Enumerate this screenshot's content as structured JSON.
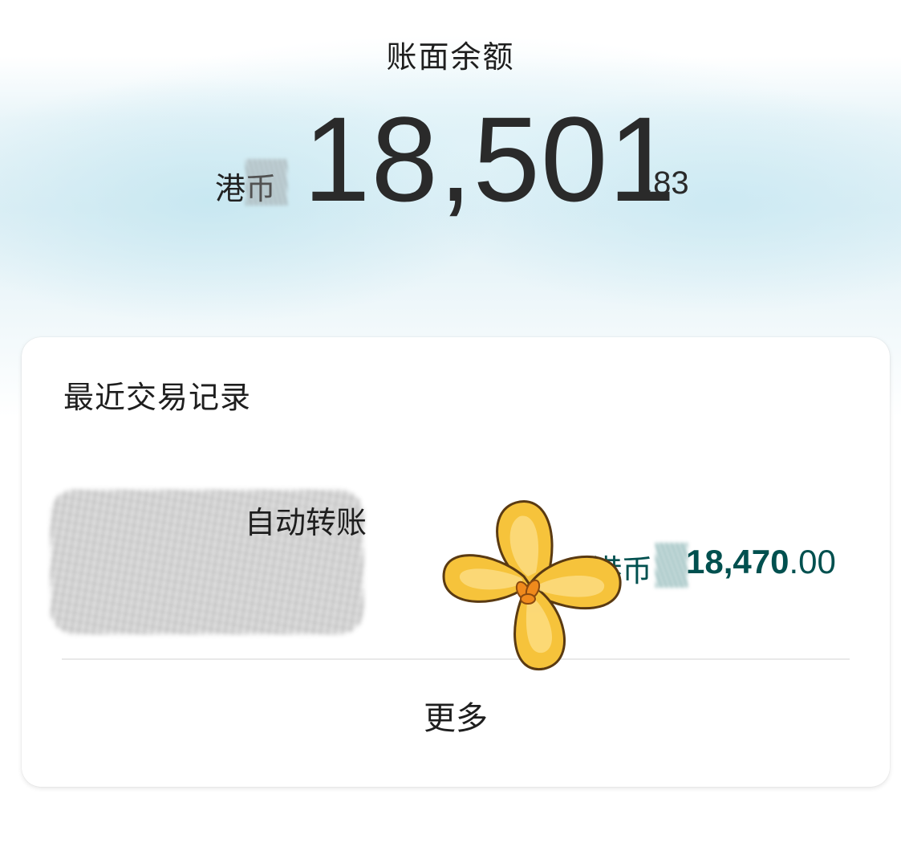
{
  "header": {
    "title": "账面余额"
  },
  "balance": {
    "currency": "港币",
    "integer_part": "18,501",
    "decimal_part": ".83"
  },
  "recent": {
    "title": "最近交易记录",
    "transactions": [
      {
        "description": "自动转账",
        "currency": "港币",
        "amount_integer": "18,470",
        "amount_decimal": ".00"
      }
    ],
    "more_label": "更多"
  },
  "colors": {
    "amount_teal": "#00504f",
    "sticker_yellow": "#f6b51e"
  },
  "icons": {
    "sticker": "flower-sticker-icon"
  }
}
